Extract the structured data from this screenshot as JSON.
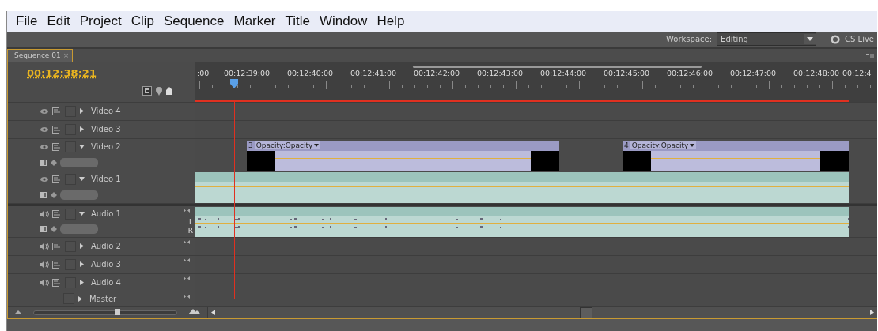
{
  "menu": [
    "File",
    "Edit",
    "Project",
    "Clip",
    "Sequence",
    "Marker",
    "Title",
    "Window",
    "Help"
  ],
  "workspace": {
    "label": "Workspace:",
    "value": "Editing"
  },
  "cs_live": "CS Live",
  "tab": {
    "label": "Sequence 01",
    "close": "×",
    "selected": true
  },
  "timecode": "00:12:38:21",
  "ruler": [
    ":00",
    "00:12:39:00",
    "00:12:40:00",
    "00:12:41:00",
    "00:12:42:00",
    "00:12:43:00",
    "00:12:44:00",
    "00:12:45:00",
    "00:12:46:00",
    "00:12:47:00",
    "00:12:48:00",
    "00:12:4"
  ],
  "tracks": [
    {
      "name": "Video 4",
      "kind": "video",
      "expanded": false
    },
    {
      "name": "Video 3",
      "kind": "video",
      "expanded": false
    },
    {
      "name": "Video 2",
      "kind": "video",
      "expanded": true,
      "clips": [
        {
          "number": "3",
          "label": "Opacity:Opacity"
        },
        {
          "number": "4",
          "label": "Opacity:Opacity"
        }
      ]
    },
    {
      "name": "Video 1",
      "kind": "video",
      "expanded": true,
      "clips": [
        {
          "kind": "plain"
        }
      ]
    },
    {
      "name": "Audio 1",
      "kind": "audio",
      "expanded": true,
      "clips": [
        {
          "kind": "audio",
          "left": "L",
          "right": "R"
        }
      ]
    },
    {
      "name": "Audio 2",
      "kind": "audio",
      "expanded": false
    },
    {
      "name": "Audio 3",
      "kind": "audio",
      "expanded": false
    },
    {
      "name": "Audio 4",
      "kind": "audio",
      "expanded": false
    },
    {
      "name": "Master",
      "kind": "master",
      "expanded": false
    }
  ],
  "zoom": {
    "level": 0.59
  }
}
